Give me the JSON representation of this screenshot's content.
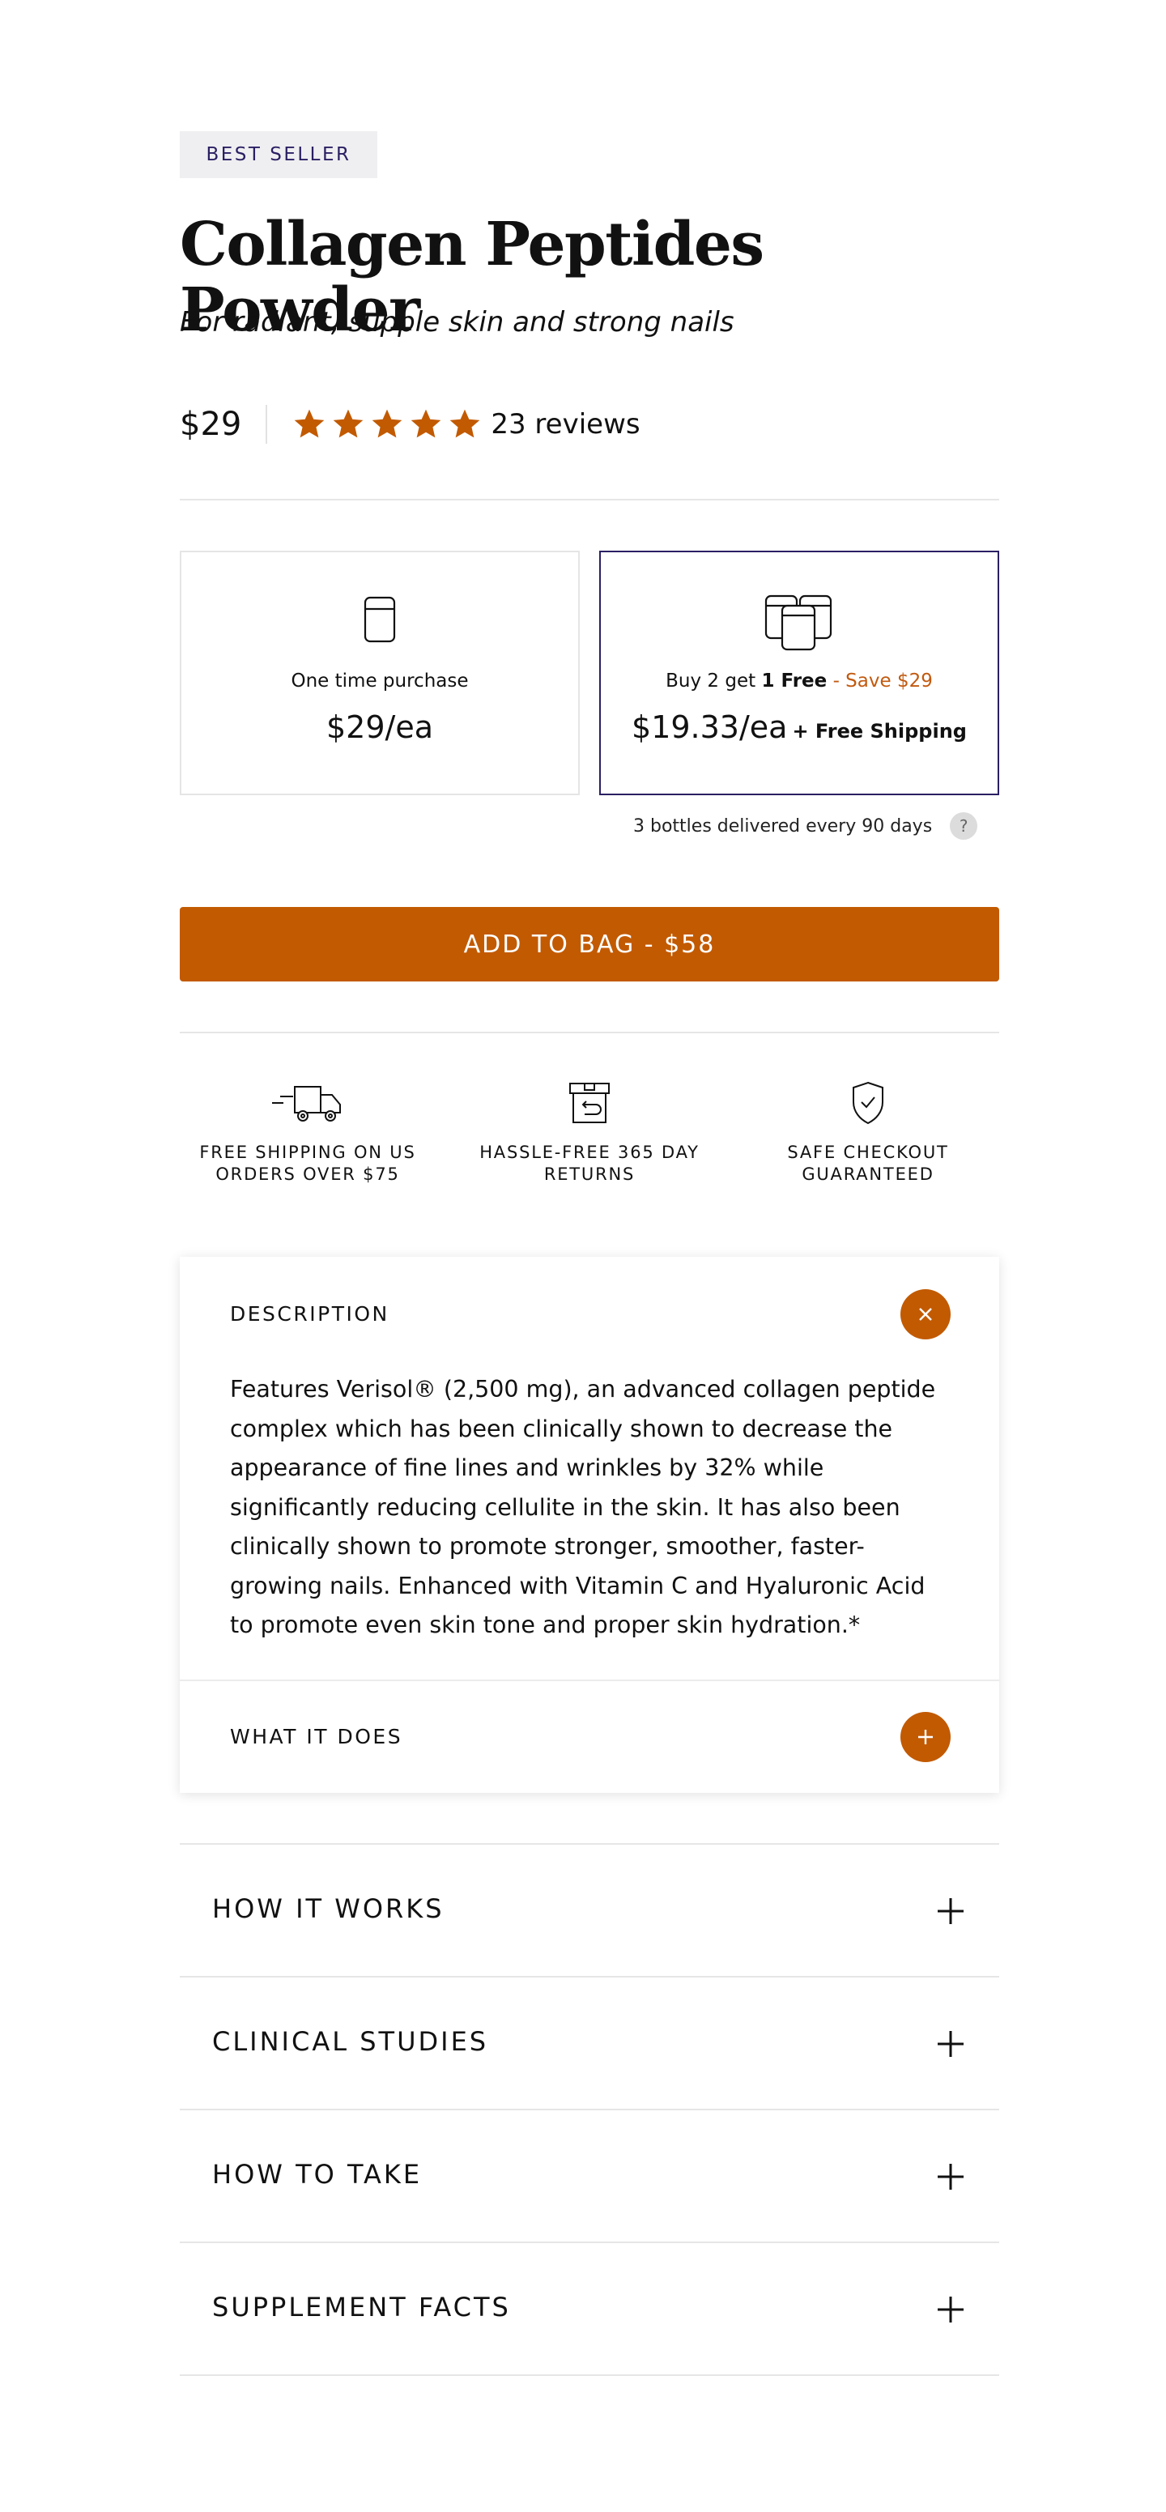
{
  "badge": "BEST SELLER",
  "product": {
    "title": "Collagen Peptides Powder",
    "subtitle": "For radiant, supple skin and strong nails",
    "price": "$29",
    "rating": 5,
    "reviews": "23 reviews"
  },
  "purchase_options": [
    {
      "label": "One time purchase",
      "price": "$29/ea",
      "selected": false
    },
    {
      "label_prefix": "Buy 2 get",
      "label_free": "1 Free",
      "label_save": "- Save $29",
      "price": "$19.33/ea",
      "shipping": "+ Free Shipping",
      "selected": true
    }
  ],
  "delivery_note": "3 bottles delivered every 90 days",
  "help_icon": "?",
  "add_to_bag": "ADD TO BAG - $58",
  "features": [
    {
      "icon": "truck-icon",
      "text": "FREE SHIPPING ON US ORDERS OVER $75"
    },
    {
      "icon": "return-box-icon",
      "text": "HASSLE-FREE 365 DAY RETURNS"
    },
    {
      "icon": "shield-check-icon",
      "text": "SAFE CHECKOUT GUARANTEED"
    }
  ],
  "description": {
    "heading": "DESCRIPTION",
    "body": "Features Verisol® (2,500 mg), an advanced collagen peptide complex which has been clinically shown to decrease the appearance of fine lines and wrinkles by 32% while significantly reducing cellulite in the skin. It has also been clinically shown to promote stronger, smoother, faster-growing nails. Enhanced with Vitamin C and Hyaluronic Acid to promote even skin tone and proper skin hydration.*",
    "expanded": true
  },
  "what_it_does": {
    "heading": "WHAT IT DOES",
    "expanded": false
  },
  "accordion": [
    {
      "label": "HOW IT WORKS"
    },
    {
      "label": "CLINICAL STUDIES"
    },
    {
      "label": "HOW TO TAKE"
    },
    {
      "label": "SUPPLEMENT FACTS"
    }
  ],
  "colors": {
    "accent": "#c25a02",
    "badge_bg": "#efeff1",
    "selected_border": "#2a1f63"
  }
}
